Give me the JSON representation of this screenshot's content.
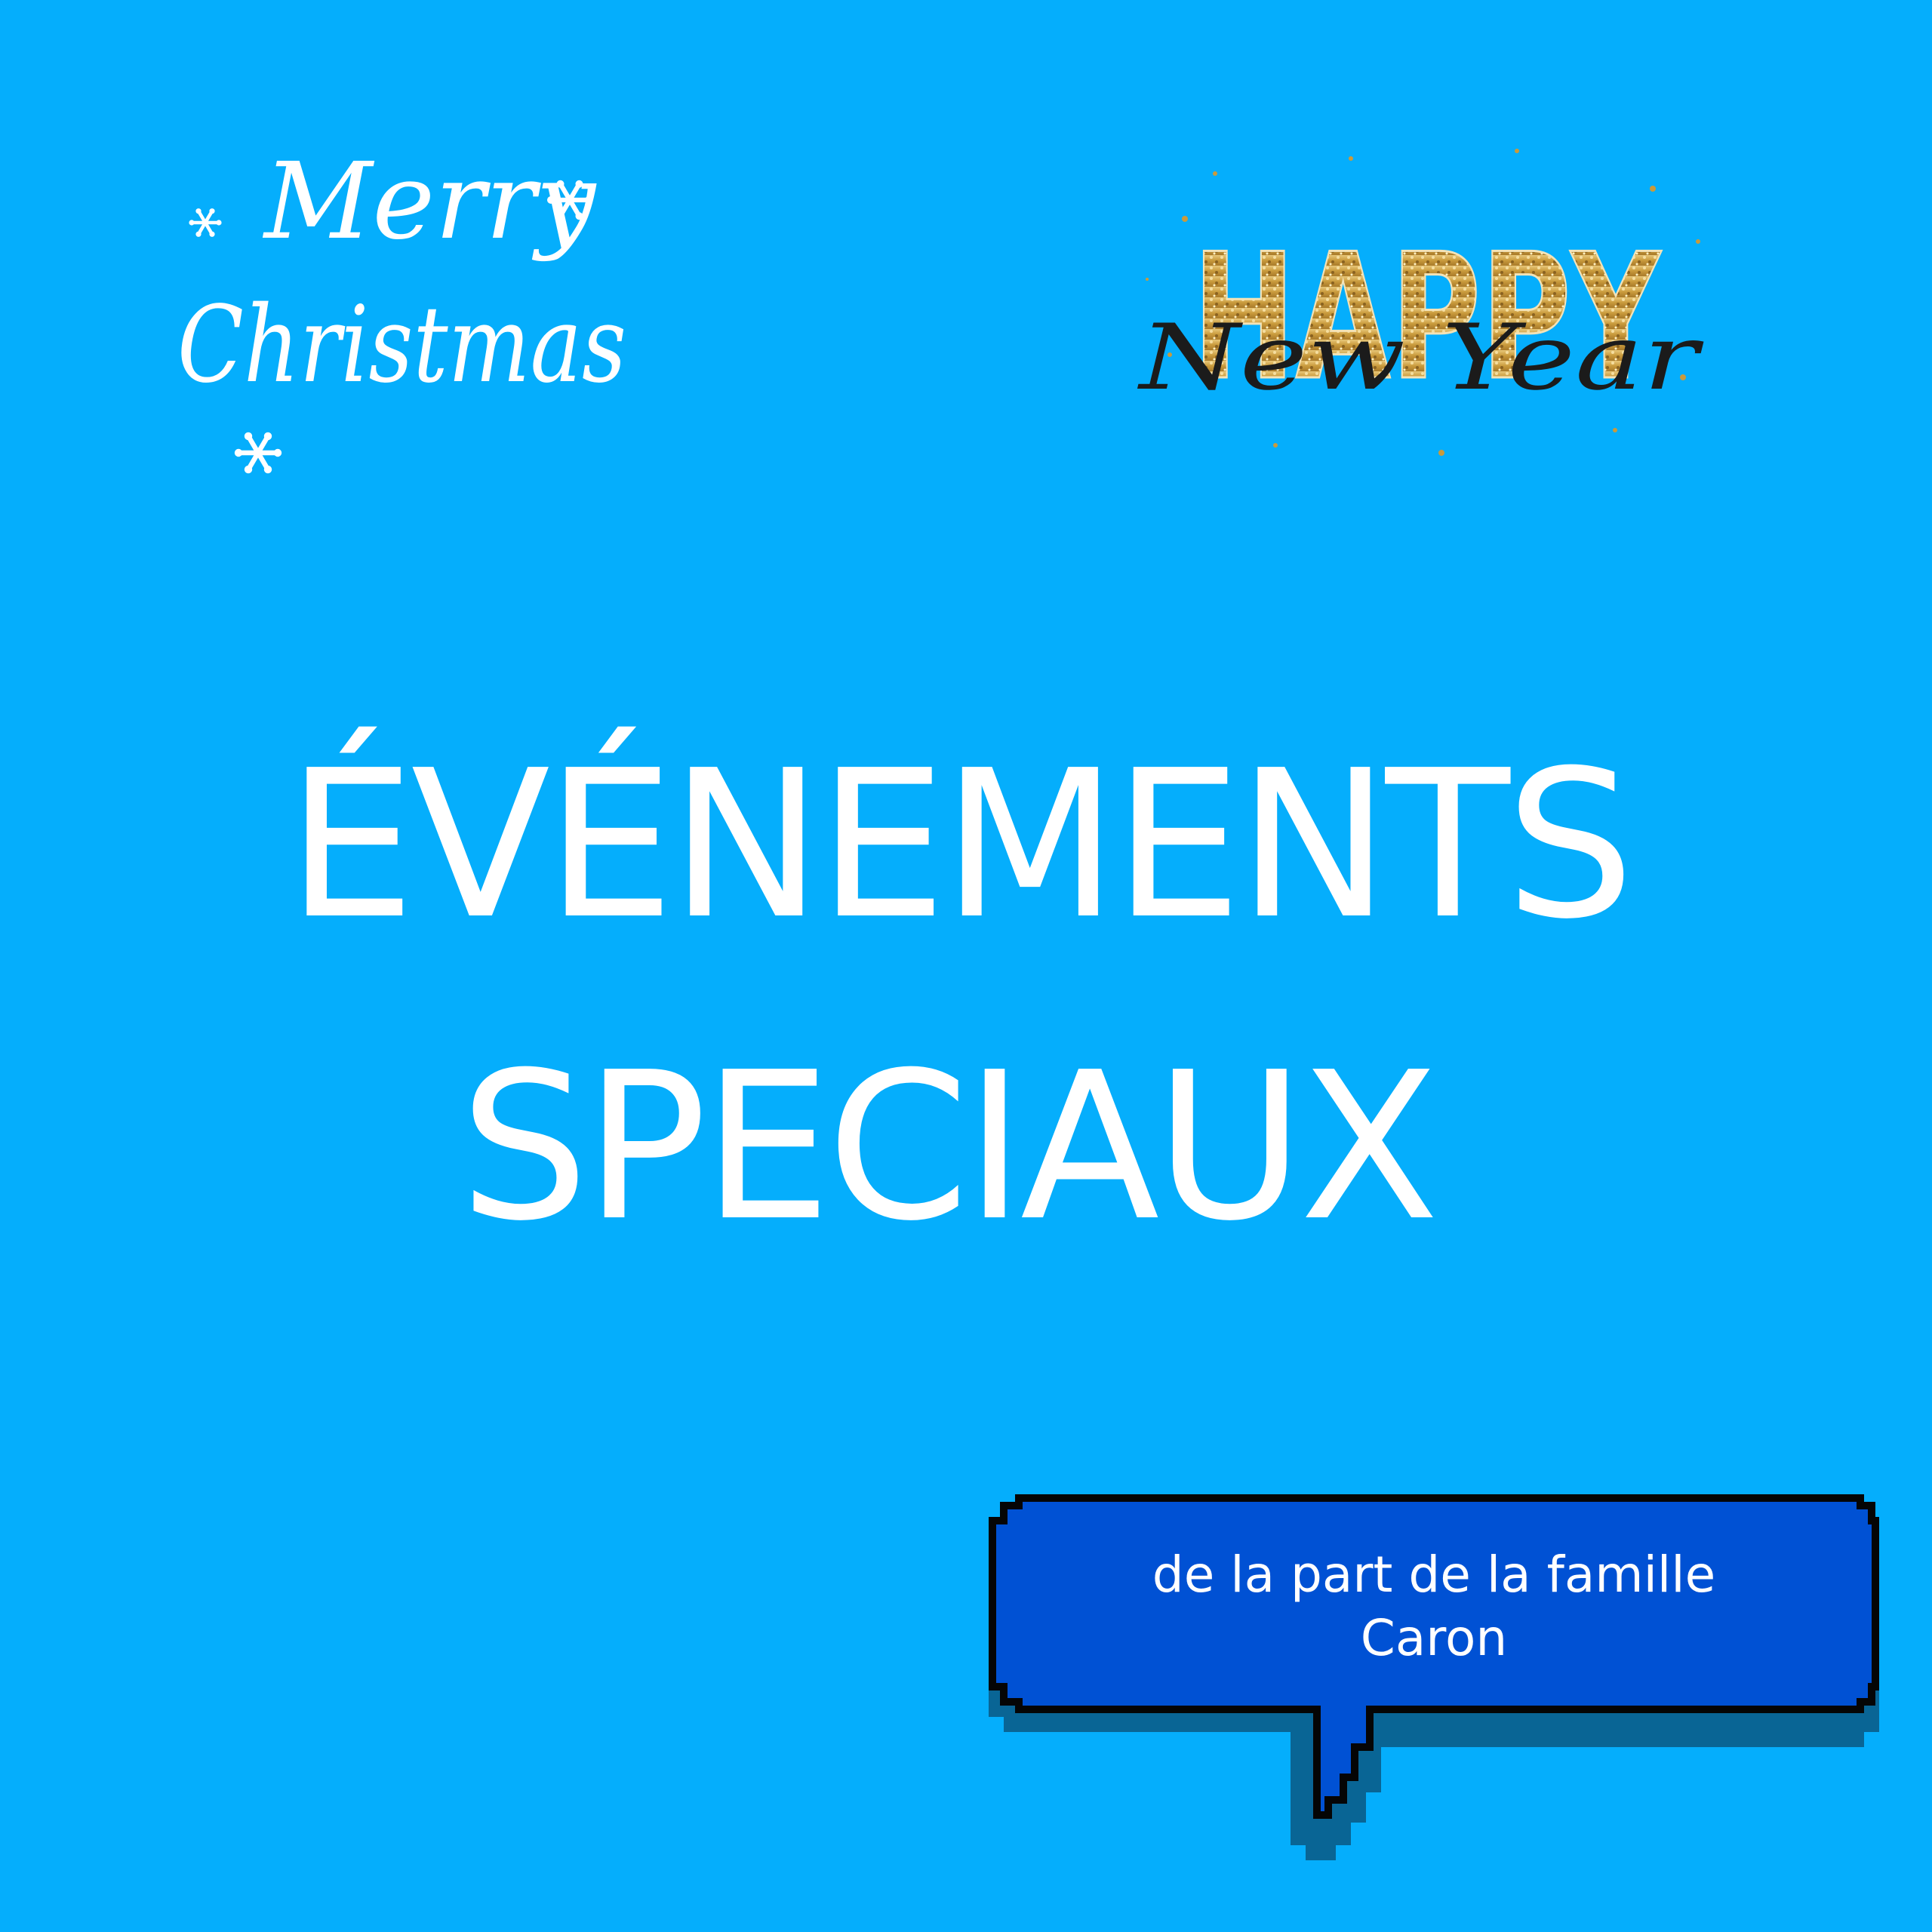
{
  "colors": {
    "background": "#05aefc",
    "title_text": "#ffffff",
    "bubble_fill": "#0051d4",
    "bubble_outline": "#050505",
    "bubble_shadow": "#0a5d8a",
    "gold": "#c99a3c"
  },
  "stickers": {
    "merry_christmas": {
      "line1": "Merry",
      "line2": "Christmas"
    },
    "happy_new_year": {
      "line1": "HAPPY",
      "line2": "New Year"
    }
  },
  "title": {
    "line1": "ÉVÉNEMENTS",
    "line2": "SPECIAUX"
  },
  "bubble": {
    "line1": "de la part de la famille",
    "line2": "Caron"
  },
  "icons": [
    "snowflake-icon",
    "speech-bubble-icon"
  ]
}
